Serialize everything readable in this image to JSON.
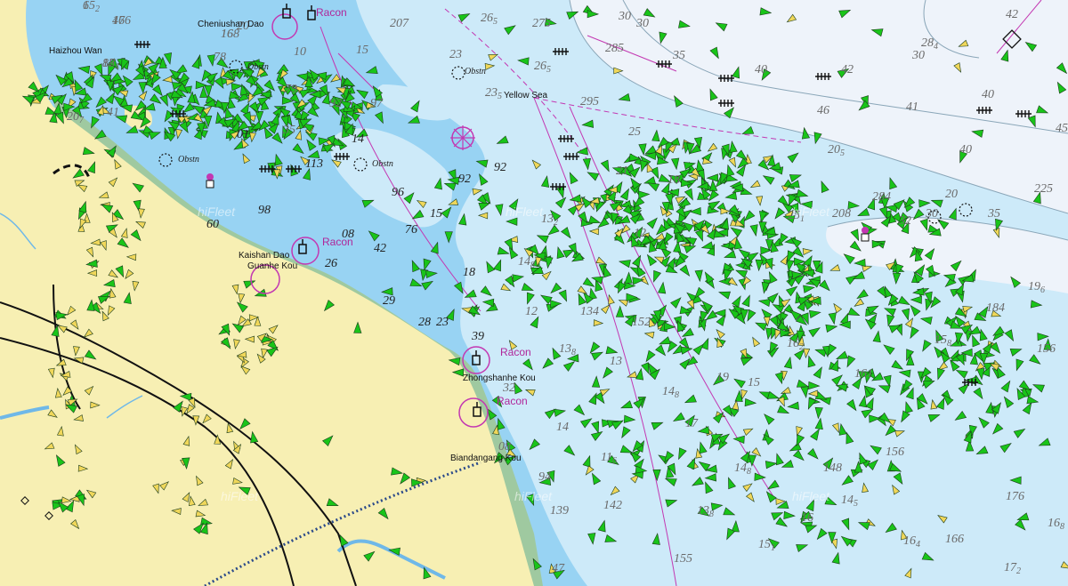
{
  "place_names": [
    {
      "id": "cheniushan",
      "text": "Cheniushan Dao"
    },
    {
      "id": "haizhou",
      "text": "Haizhou Wan"
    },
    {
      "id": "yellow-sea",
      "text": "Yellow Sea"
    },
    {
      "id": "kaishan",
      "text": "Kaishan Dao"
    },
    {
      "id": "guanhe",
      "text": "Guanhe Kou"
    },
    {
      "id": "zhongshanhe",
      "text": "Zhongshanhe Kou"
    },
    {
      "id": "biandan",
      "text": "Biandangang Kou"
    }
  ],
  "racon_labels": [
    "Racon",
    "Racon",
    "Racon",
    "Racon"
  ],
  "obstn_labels": [
    "Obstn",
    "Obstn",
    "Obstn",
    "Obstn"
  ],
  "watermark": "hiFleet",
  "depth_soundings": [
    "6",
    "46",
    "88",
    "16",
    "10",
    "79",
    "20",
    "207",
    "265",
    "275",
    "30",
    "30",
    "42",
    "285",
    "265",
    "35",
    "40",
    "42",
    "284",
    "30",
    "23",
    "295",
    "235",
    "46",
    "41",
    "40",
    "45",
    "40",
    "25",
    "21",
    "18",
    "15",
    "92",
    "96",
    "76",
    "92",
    "132",
    "12",
    "148",
    "18",
    "12",
    "134",
    "138",
    "152",
    "148",
    "14",
    "116",
    "142",
    "138",
    "155",
    "151",
    "156",
    "168",
    "176",
    "172",
    "166",
    "164",
    "156",
    "158",
    "184",
    "196",
    "225",
    "35",
    "32",
    "30",
    "20",
    "205",
    "284",
    "251",
    "208",
    "207",
    "41",
    "01",
    "15",
    "14",
    "113",
    "78",
    "98",
    "60",
    "28",
    "42",
    "26",
    "08",
    "29",
    "23",
    "39",
    "32",
    "08",
    "94",
    "139",
    "47",
    "92",
    "97",
    "35",
    "13",
    "17",
    "19",
    "15",
    "148",
    "148",
    "145",
    "16",
    "162",
    "161",
    "152",
    "176",
    "174",
    "168"
  ],
  "colors": {
    "land": "#f7efb3",
    "shallow_water": "#98d3f3",
    "mid_water": "#cdeaf9",
    "deep_water": "#eef3fa",
    "intertidal": "#9fc9a0",
    "vessel_moving": "#19c419",
    "vessel_anchored": "#f0d75a",
    "magenta": "#c338b2"
  }
}
